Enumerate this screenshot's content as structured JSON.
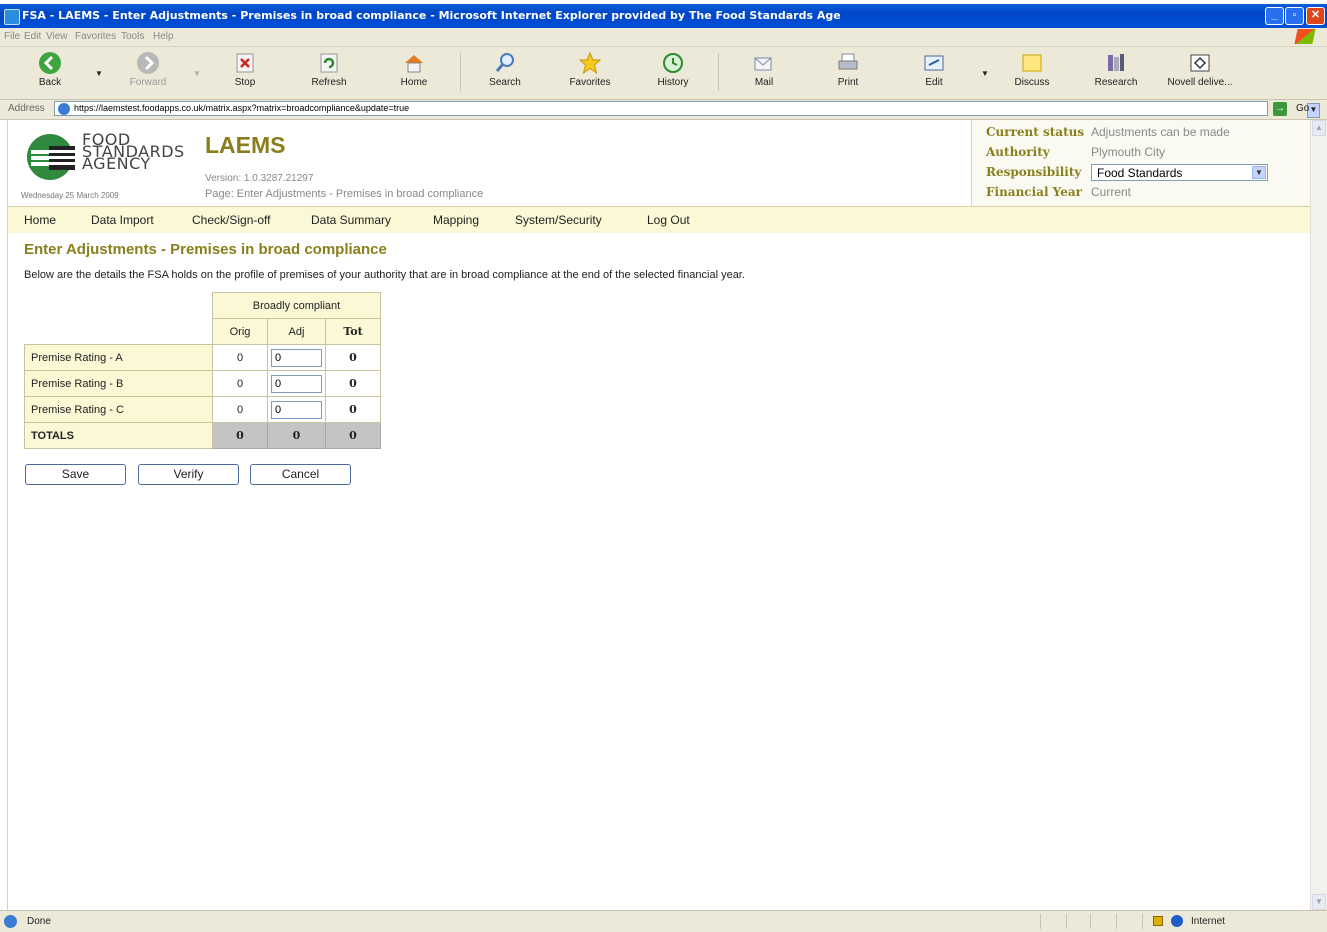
{
  "window": {
    "title": "FSA - LAEMS - Enter Adjustments - Premises in broad compliance - Microsoft Internet Explorer provided by The Food Standards Age"
  },
  "menubar": [
    "File",
    "Edit",
    "View",
    "Favorites",
    "Tools",
    "Help"
  ],
  "toolbar": {
    "back": "Back",
    "forward": "Forward",
    "stop": "Stop",
    "refresh": "Refresh",
    "home": "Home",
    "search": "Search",
    "favorites": "Favorites",
    "history": "History",
    "mail": "Mail",
    "print": "Print",
    "edit": "Edit",
    "discuss": "Discuss",
    "research": "Research",
    "novell": "Novell delive..."
  },
  "address": {
    "label": "Address",
    "url": "https://laemstest.foodapps.co.uk/matrix.aspx?matrix=broadcompliance&update=true",
    "go": "Go"
  },
  "header": {
    "org_lines": [
      "FOOD",
      "STANDARDS",
      "AGENCY"
    ],
    "date": "Wednesday 25 March 2009",
    "app_name": "LAEMS",
    "version": "Version: 1.0.3287.21297",
    "page": "Page: Enter Adjustments - Premises in broad compliance"
  },
  "status_panel": {
    "current_status_label": "Current status",
    "current_status_value": "Adjustments can be made",
    "authority_label": "Authority",
    "authority_value": "Plymouth City",
    "responsibility_label": "Responsibility",
    "responsibility_value": "Food Standards",
    "financial_year_label": "Financial Year",
    "financial_year_value": "Current"
  },
  "nav": {
    "home": "Home",
    "data_import": "Data Import",
    "check_signoff": "Check/Sign-off",
    "data_summary": "Data Summary",
    "mapping": "Mapping",
    "system_security": "System/Security",
    "log_out": "Log Out"
  },
  "main": {
    "title": "Enter Adjustments - Premises in broad compliance",
    "description": "Below are the details the FSA holds on the profile of premises of your authority that are in broad compliance at the end of the selected financial year."
  },
  "grid": {
    "group_header": "Broadly compliant",
    "col_orig": "Orig",
    "col_adj": "Adj",
    "col_tot": "Tot",
    "rows": [
      {
        "label": "Premise Rating - A",
        "orig": "0",
        "adj": "0",
        "tot": "0"
      },
      {
        "label": "Premise Rating - B",
        "orig": "0",
        "adj": "0",
        "tot": "0"
      },
      {
        "label": "Premise Rating - C",
        "orig": "0",
        "adj": "0",
        "tot": "0"
      }
    ],
    "totals": {
      "label": "TOTALS",
      "orig": "0",
      "adj": "0",
      "tot": "0"
    }
  },
  "buttons": {
    "save": "Save",
    "verify": "Verify",
    "cancel": "Cancel"
  },
  "statusbar": {
    "text": "Done",
    "zone": "Internet"
  },
  "colors": {
    "accent_olive": "#8a7f1d",
    "nav_bg": "#fbf8d6",
    "title_blue": "#0050d8"
  }
}
